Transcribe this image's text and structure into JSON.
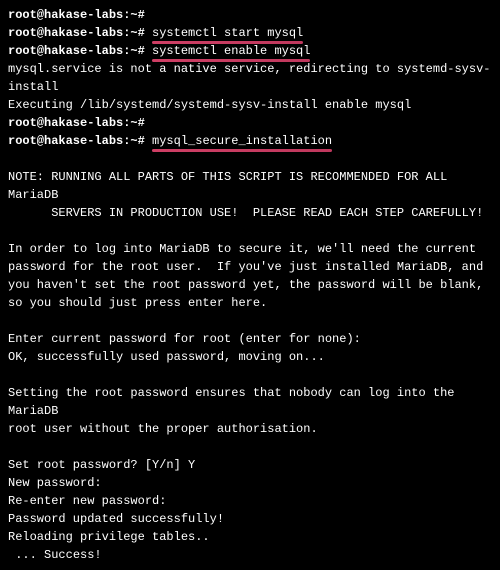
{
  "prompt": "root@hakase-labs:~#",
  "cmd": {
    "start": "systemctl start mysql",
    "enable": "systemctl enable mysql",
    "secure": "mysql_secure_installation"
  },
  "out": {
    "redirect": "mysql.service is not a native service, redirecting to systemd-sysv-install",
    "executing": "Executing /lib/systemd/systemd-sysv-install enable mysql",
    "note_heading": "NOTE: RUNNING ALL PARTS OF THIS SCRIPT IS RECOMMENDED FOR ALL MariaDB",
    "note_line2": "SERVERS IN PRODUCTION USE!  PLEASE READ EACH STEP CAREFULLY!",
    "explain1": "In order to log into MariaDB to secure it, we'll need the current",
    "explain2": "password for the root user.  If you've just installed MariaDB, and",
    "explain3": "you haven't set the root password yet, the password will be blank,",
    "explain4": "so you should just press enter here.",
    "enter_pw": "Enter current password for root (enter for none):",
    "ok_pw": "OK, successfully used password, moving on...",
    "set_info1": "Setting the root password ensures that nobody can log into the MariaDB",
    "set_info2": "root user without the proper authorisation.",
    "set_q": "Set root password? [Y/n] Y",
    "newpw": "New password:",
    "renew": "Re-enter new password:",
    "updated": "Password updated successfully!",
    "reload": "Reloading privilege tables..",
    "success": " ... Success!"
  }
}
